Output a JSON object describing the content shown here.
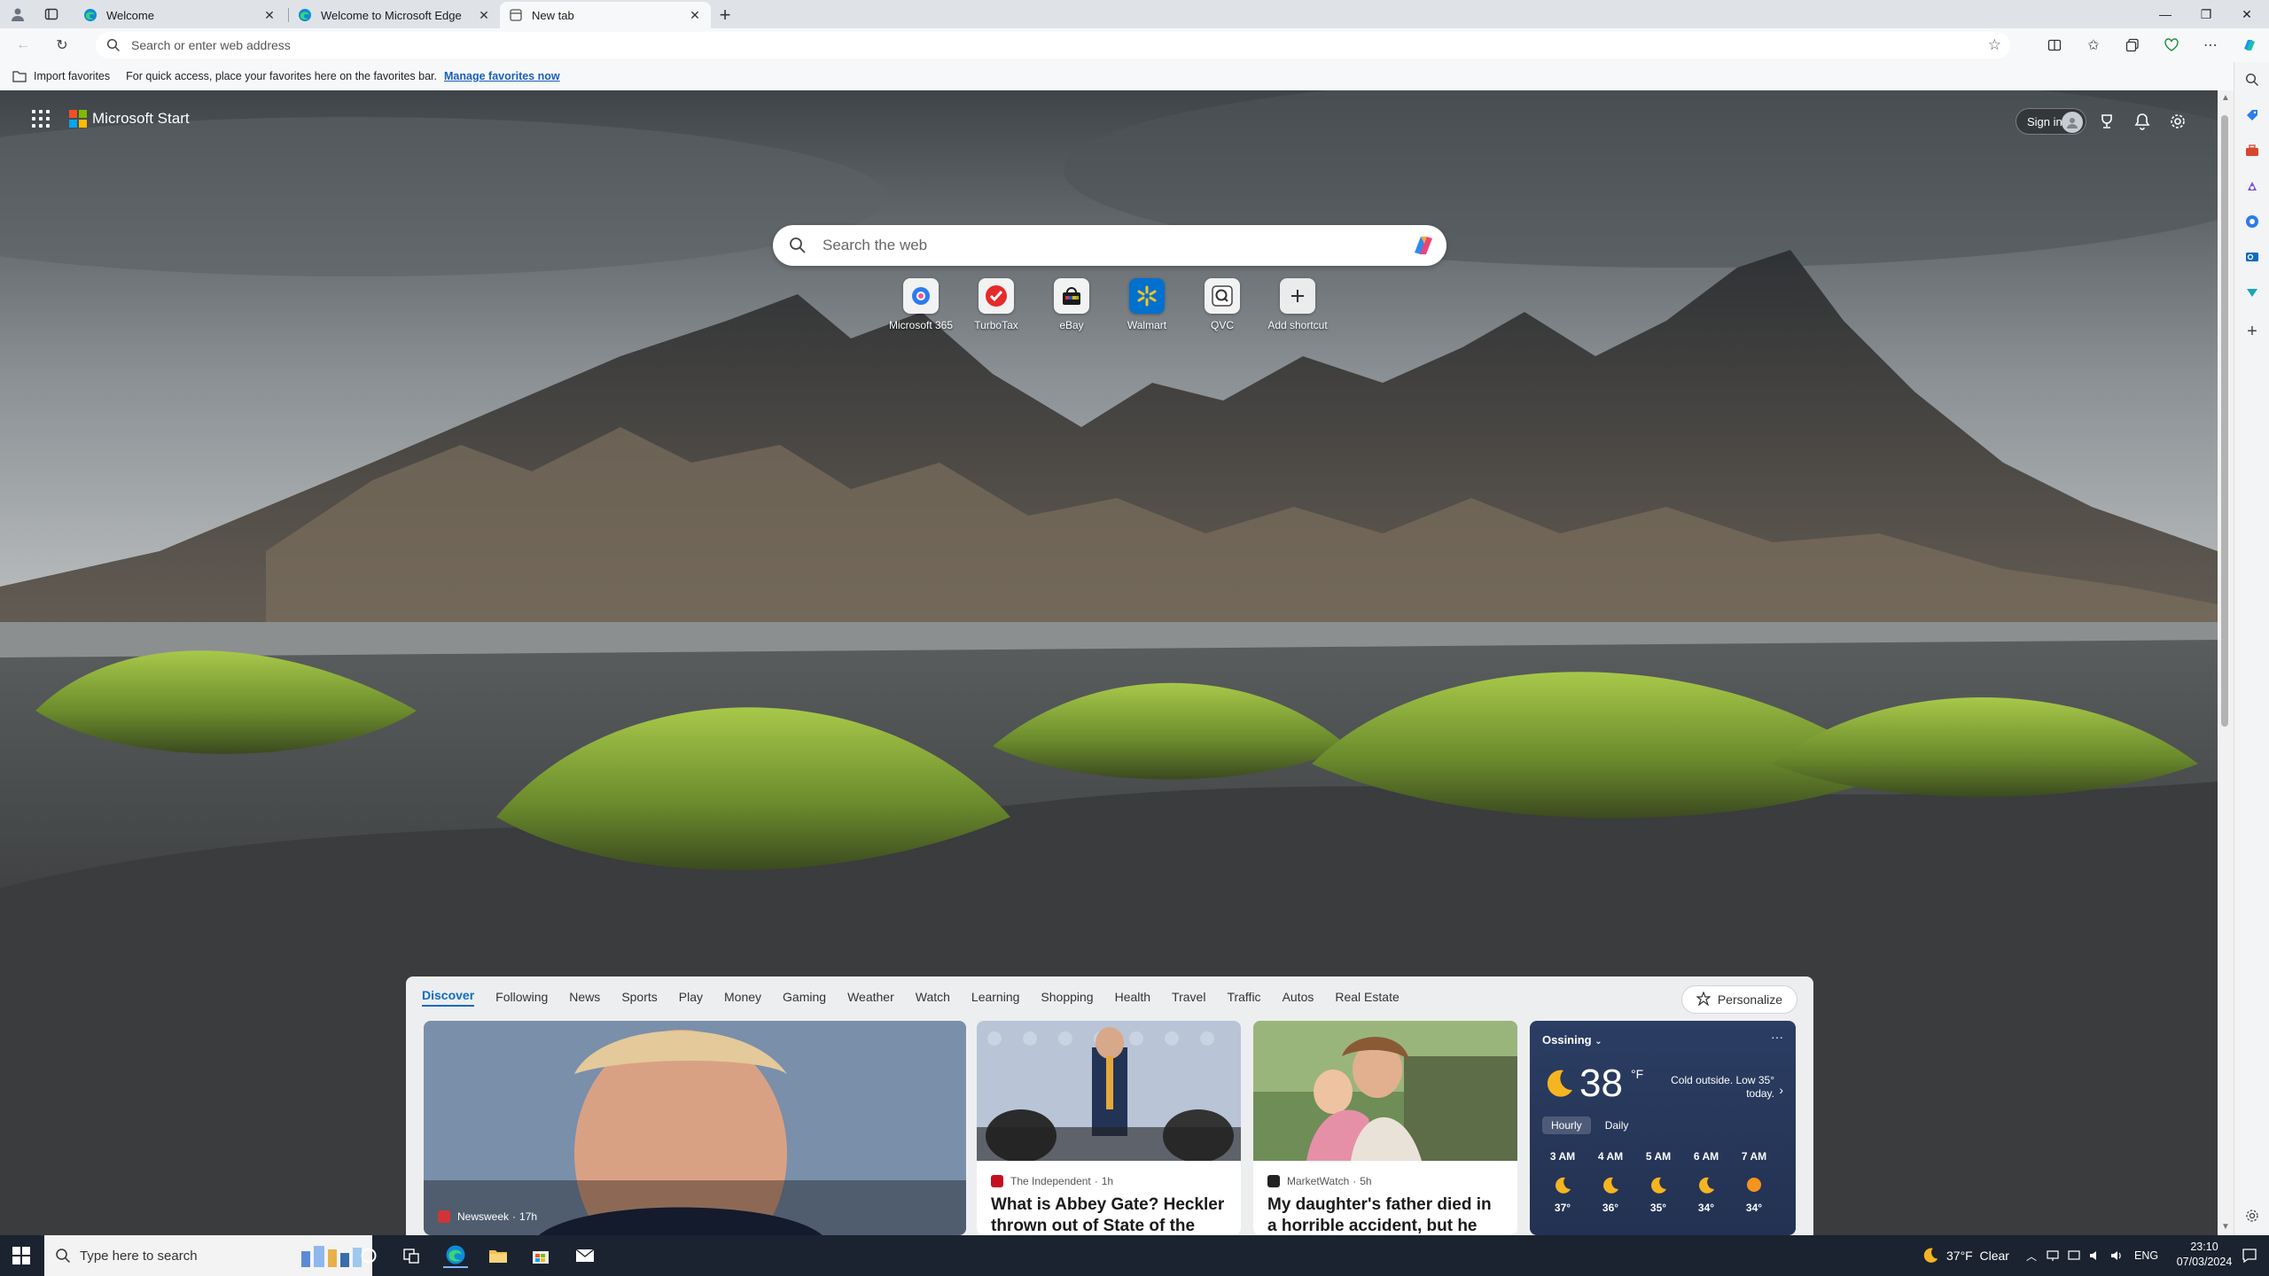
{
  "browser": {
    "tabs": [
      {
        "title": "Welcome",
        "active": false
      },
      {
        "title": "Welcome to Microsoft Edge",
        "active": false
      },
      {
        "title": "New tab",
        "active": true
      }
    ],
    "address_placeholder": "Search or enter web address",
    "favorites_bar": {
      "import_label": "Import favorites",
      "message": "For quick access, place your favorites here on the favorites bar.",
      "link": "Manage favorites now"
    }
  },
  "page": {
    "brand": "Microsoft Start",
    "signin_label": "Sign in",
    "search_placeholder": "Search the web",
    "shortcuts": [
      {
        "label": "Microsoft 365",
        "icon": "microsoft-365-icon"
      },
      {
        "label": "TurboTax",
        "icon": "turbotax-icon"
      },
      {
        "label": "eBay",
        "icon": "ebay-icon"
      },
      {
        "label": "Walmart",
        "icon": "walmart-icon"
      },
      {
        "label": "QVC",
        "icon": "qvc-icon"
      },
      {
        "label": "Add shortcut",
        "icon": "plus-icon"
      }
    ]
  },
  "feed": {
    "categories": [
      "Discover",
      "Following",
      "News",
      "Sports",
      "Play",
      "Money",
      "Gaming",
      "Weather",
      "Watch",
      "Learning",
      "Shopping",
      "Health",
      "Travel",
      "Traffic",
      "Autos",
      "Real Estate"
    ],
    "active_category": "Discover",
    "personalize_label": "Personalize",
    "cards": [
      {
        "source": "Newsweek",
        "time": "17h",
        "headline": "",
        "source_color": "#d13438"
      },
      {
        "source": "The Independent",
        "time": "1h",
        "headline": "What is Abbey Gate? Heckler thrown out of State of the",
        "source_color": "#c50f1f"
      },
      {
        "source": "MarketWatch",
        "time": "5h",
        "headline": "My daughter's father died in a horrible accident, but he",
        "source_color": "#222222"
      }
    ]
  },
  "weather": {
    "location": "Ossining",
    "temperature": "38",
    "unit": "°F",
    "description": "Cold outside. Low 35° today.",
    "tabs": [
      "Hourly",
      "Daily"
    ],
    "hours": [
      {
        "time": "3 AM",
        "temp": "37°",
        "icon": "moon-icon"
      },
      {
        "time": "4 AM",
        "temp": "36°",
        "icon": "moon-icon"
      },
      {
        "time": "5 AM",
        "temp": "35°",
        "icon": "moon-icon"
      },
      {
        "time": "6 AM",
        "temp": "34°",
        "icon": "moon-icon"
      },
      {
        "time": "7 AM",
        "temp": "34°",
        "icon": "sun-icon"
      }
    ]
  },
  "taskbar": {
    "search_placeholder": "Type here to search",
    "weather": "37°F  Clear",
    "language": "ENG",
    "time": "23:10",
    "date": "07/03/2024"
  }
}
